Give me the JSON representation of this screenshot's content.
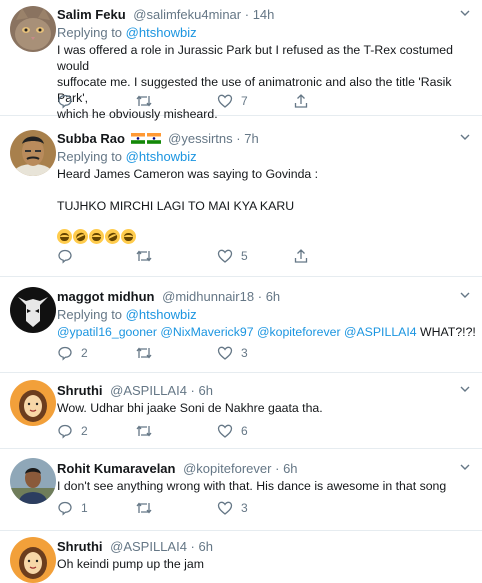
{
  "tweets": [
    {
      "name": "Salim Feku",
      "handle": "@salimfeku4minar",
      "dot": "·",
      "time": "14h",
      "replying_to_label": "Replying to",
      "replying_to": "@htshowbiz",
      "lines": [
        "I was offered a role in Jurassic Park but I refused as the T-Rex costumed would",
        "suffocate me. I suggested the use of animatronic and also the title 'Rasik Park',",
        "which he obviously misheard."
      ],
      "reply_count": "",
      "retweet_count": "",
      "like_count": "7"
    },
    {
      "name": "Subba Rao",
      "handle": "@yessirtns",
      "dot": "·",
      "time": "7h",
      "replying_to_label": "Replying to",
      "replying_to": "@htshowbiz",
      "line1": "Heard James Cameron was saying to Govinda :",
      "line2": "TUJHKO MIRCHI LAGI TO MAI KYA KARU",
      "reply_count": "",
      "retweet_count": "",
      "like_count": "5"
    },
    {
      "name": "maggot midhun",
      "handle": "@midhunnair18",
      "dot": "·",
      "time": "6h",
      "replying_to_label": "Replying to",
      "replying_to": "@htshowbiz",
      "mentions": [
        "@ypatil16_gooner",
        "@NixMaverick97",
        "@kopiteforever",
        "@ASPILLAI4"
      ],
      "text_tail": "WHAT?!?!",
      "reply_count": "2",
      "retweet_count": "",
      "like_count": "3"
    },
    {
      "name": "Shruthi",
      "handle": "@ASPILLAI4",
      "dot": "·",
      "time": "6h",
      "line": "Wow. Udhar bhi jaake Soni de Nakhre gaata tha.",
      "reply_count": "2",
      "retweet_count": "",
      "like_count": "6"
    },
    {
      "name": "Rohit Kumaravelan",
      "handle": "@kopiteforever",
      "dot": "·",
      "time": "6h",
      "line": "I don't see anything wrong with that. His dance is awesome in that song",
      "reply_count": "1",
      "retweet_count": "",
      "like_count": "3"
    },
    {
      "name": "Shruthi",
      "handle": "@ASPILLAI4",
      "dot": "·",
      "time": "6h",
      "line": "Oh keindi pump up the jam"
    }
  ],
  "colors": {
    "link": "#1b95e0",
    "muted": "#657786",
    "divider": "#e6ecf0"
  },
  "icons": [
    "reply-icon",
    "retweet-icon",
    "like-icon",
    "share-icon",
    "caret-down-icon"
  ]
}
